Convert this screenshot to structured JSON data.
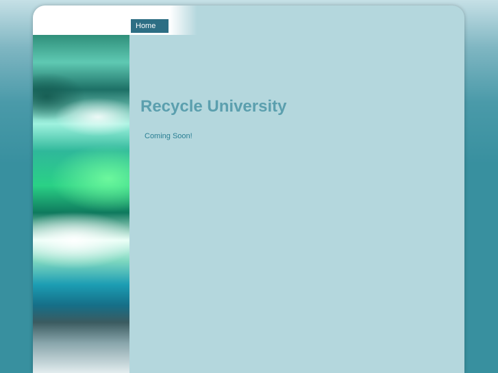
{
  "nav": {
    "items": [
      {
        "label": "Home"
      }
    ]
  },
  "header": {
    "title": "Recycle University"
  },
  "main": {
    "message": "Coming Soon!"
  },
  "colors": {
    "page_background": "#38909f",
    "panel_background": "#b4d7dd",
    "nav_background": "#2d6e84",
    "title_color": "#5b9fae",
    "body_text_color": "#2a7f93"
  }
}
